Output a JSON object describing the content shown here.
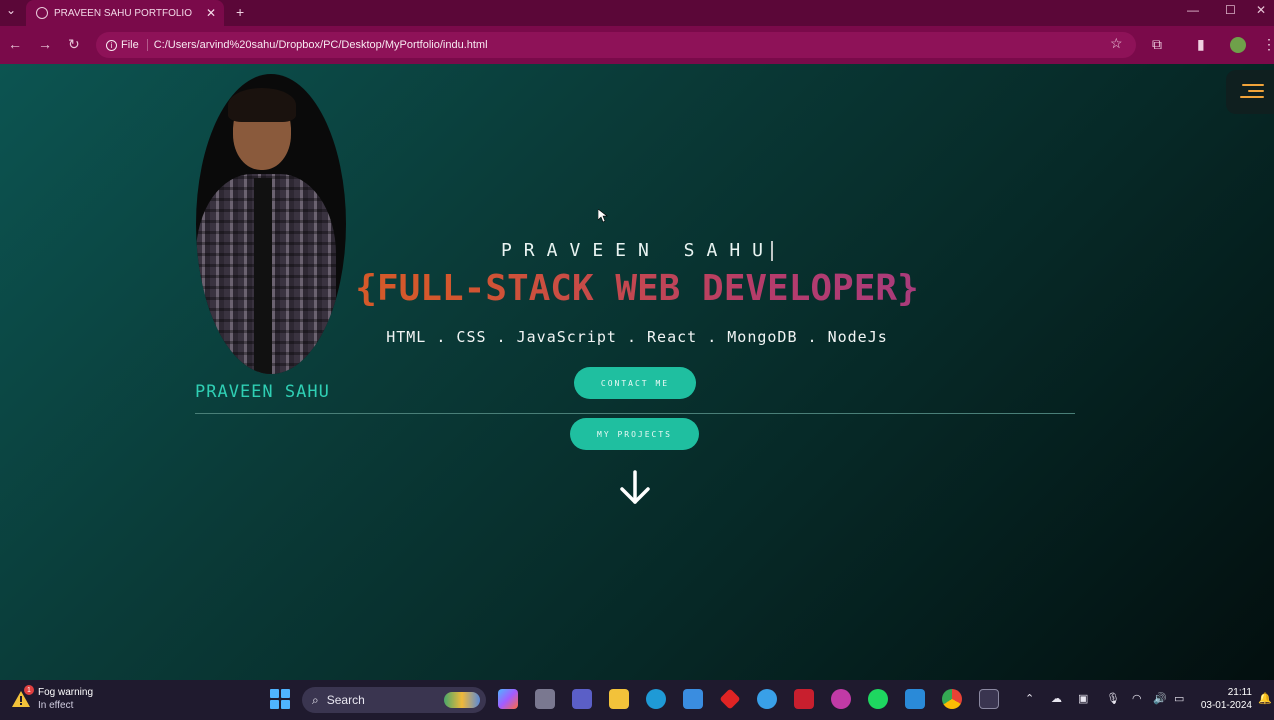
{
  "browser": {
    "tab_title": "PRAVEEN SAHU PORTFOLIO",
    "url_label": "File",
    "url": "C:/Users/arvind%20sahu/Dropbox/PC/Desktop/MyPortfolio/indu.html"
  },
  "page": {
    "portrait_name": "PRAVEEN SAHU",
    "hero_name": "PRAVEEN SAHU",
    "role": "{FULL-STACK WEB DEVELOPER}",
    "skills": "HTML . CSS . JavaScript . React . MongoDB . NodeJs",
    "contact_button": "CONTACT ME",
    "projects_button": "MY PROJECTS"
  },
  "taskbar": {
    "weather_title": "Fog warning",
    "weather_sub": "In effect",
    "weather_badge": "1",
    "search_label": "Search",
    "time": "21:11",
    "date": "03-01-2024"
  },
  "colors": {
    "accent": "#1fbfa0",
    "name_color": "#2fcfb4",
    "browser": "#7a0a4a"
  }
}
